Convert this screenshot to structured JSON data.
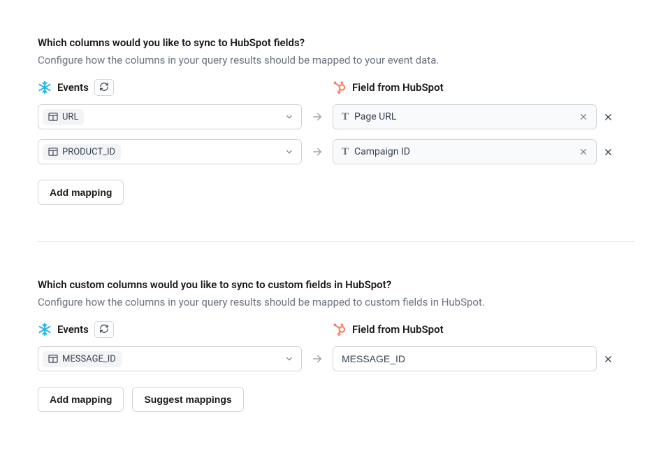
{
  "section1": {
    "title": "Which columns would you like to sync to HubSpot fields?",
    "desc": "Configure how the columns in your query results should be mapped to your event data.",
    "left_header": "Events",
    "right_header": "Field from HubSpot",
    "rows": [
      {
        "source": "URL",
        "target": "Page URL"
      },
      {
        "source": "PRODUCT_ID",
        "target": "Campaign ID"
      }
    ],
    "add_label": "Add mapping"
  },
  "section2": {
    "title": "Which custom columns would you like to sync to custom fields in HubSpot?",
    "desc": "Configure how the columns in your query results should be mapped to custom fields in HubSpot.",
    "left_header": "Events",
    "right_header": "Field from HubSpot",
    "rows": [
      {
        "source": "MESSAGE_ID",
        "target": "MESSAGE_ID"
      }
    ],
    "add_label": "Add mapping",
    "suggest_label": "Suggest mappings"
  }
}
